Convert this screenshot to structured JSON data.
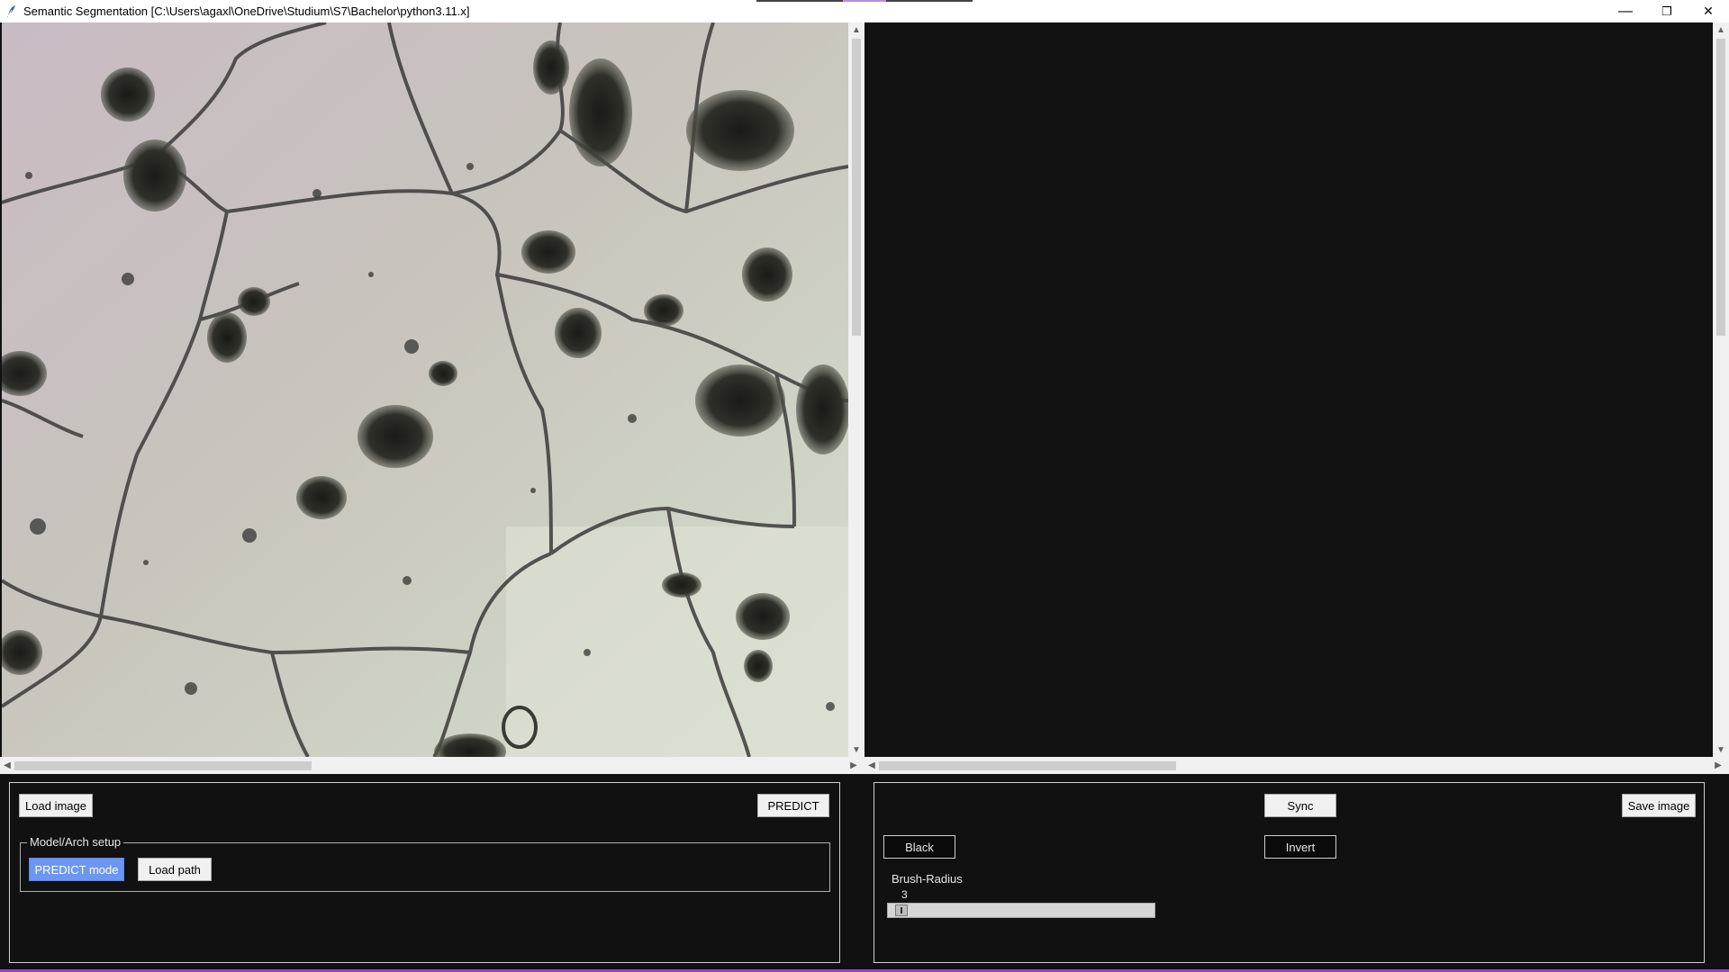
{
  "window": {
    "title": "Semantic Segmentation [C:\\Users\\agaxl\\OneDrive\\Studium\\S7\\Bachelor\\python3.11.x]",
    "minimize_glyph": "—",
    "restore_glyph": "❐",
    "close_glyph": "✕",
    "icon": "feather-icon"
  },
  "left_panel": {
    "image": "micrograph-grain-boundaries",
    "vscroll_arrow_up": "▲",
    "vscroll_arrow_down": "▼",
    "hscroll_arrow_left": "◀",
    "hscroll_arrow_right": "▶",
    "vscroll_position": 0.0,
    "hscroll_position": 0.0
  },
  "right_panel": {
    "vscroll_arrow_up": "▲",
    "vscroll_arrow_down": "▼",
    "hscroll_arrow_left": "◀",
    "hscroll_arrow_right": "▶",
    "vscroll_position": 0.0,
    "hscroll_position": 0.0
  },
  "left_controls": {
    "load_image_label": "Load image",
    "predict_label": "PREDICT",
    "model_frame_label": "Model/Arch setup",
    "predict_mode_label": "PREDICT mode",
    "load_path_label": "Load path"
  },
  "right_controls": {
    "sync_label": "Sync",
    "save_image_label": "Save image",
    "black_label": "Black",
    "invert_label": "Invert",
    "brush_radius_label": "Brush-Radius",
    "brush_radius_value": "3"
  },
  "colors": {
    "background": "#111111",
    "accent_button": "#6b97f2",
    "taskbar_accent": "#9b3fcf"
  }
}
